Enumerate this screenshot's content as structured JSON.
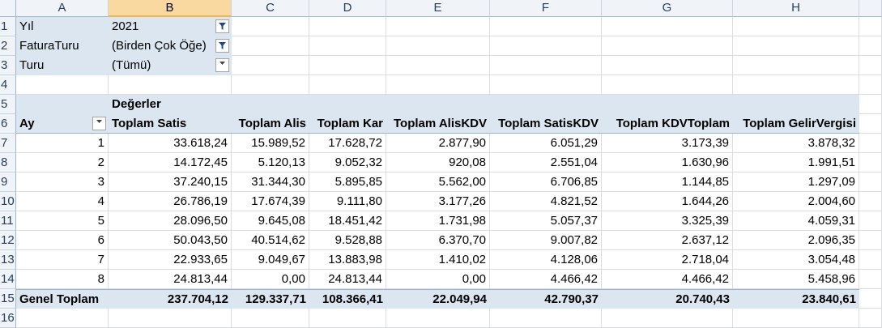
{
  "columns": [
    "A",
    "B",
    "C",
    "D",
    "E",
    "F",
    "G",
    "H"
  ],
  "selected_column": "B",
  "row_numbers": [
    "1",
    "2",
    "3",
    "4",
    "5",
    "6",
    "7",
    "8",
    "9",
    "10",
    "11",
    "12",
    "13",
    "14",
    "15",
    "16"
  ],
  "filters": [
    {
      "label": "Yıl",
      "value": "2021",
      "filtered": true
    },
    {
      "label": "FaturaTuru",
      "value": "(Birden Çok Öğe)",
      "filtered": true
    },
    {
      "label": "Turu",
      "value": "(Tümü)",
      "filtered": false
    }
  ],
  "pivot": {
    "values_caption": "Değerler",
    "row_field": "Ay",
    "headers": [
      "Toplam Satis",
      "Toplam Alis",
      "Toplam Kar",
      "Toplam AlisKDV",
      "Toplam SatisKDV",
      "Toplam KDVToplam",
      "Toplam GelirVergisi"
    ],
    "rows": [
      {
        "ay": "1",
        "values": [
          "33.618,24",
          "15.989,52",
          "17.628,72",
          "2.877,90",
          "6.051,29",
          "3.173,39",
          "3.878,32"
        ]
      },
      {
        "ay": "2",
        "values": [
          "14.172,45",
          "5.120,13",
          "9.052,32",
          "920,08",
          "2.551,04",
          "1.630,96",
          "1.991,51"
        ]
      },
      {
        "ay": "3",
        "values": [
          "37.240,15",
          "31.344,30",
          "5.895,85",
          "5.562,00",
          "6.706,85",
          "1.144,85",
          "1.297,09"
        ]
      },
      {
        "ay": "4",
        "values": [
          "26.786,19",
          "17.674,39",
          "9.111,80",
          "3.177,26",
          "4.821,52",
          "1.644,26",
          "2.004,60"
        ]
      },
      {
        "ay": "5",
        "values": [
          "28.096,50",
          "9.645,08",
          "18.451,42",
          "1.731,98",
          "5.057,37",
          "3.325,39",
          "4.059,31"
        ]
      },
      {
        "ay": "6",
        "values": [
          "50.043,50",
          "40.514,62",
          "9.528,88",
          "6.370,70",
          "9.007,82",
          "2.637,12",
          "2.096,35"
        ]
      },
      {
        "ay": "7",
        "values": [
          "22.933,65",
          "9.049,67",
          "13.883,98",
          "1.410,02",
          "4.128,06",
          "2.718,04",
          "3.054,48"
        ]
      },
      {
        "ay": "8",
        "values": [
          "24.813,44",
          "0,00",
          "24.813,44",
          "0,00",
          "4.466,42",
          "4.466,42",
          "5.458,96"
        ]
      }
    ],
    "total_label": "Genel Toplam",
    "totals": [
      "237.704,12",
      "129.337,71",
      "108.366,41",
      "22.049,94",
      "42.790,37",
      "20.740,43",
      "23.840,61"
    ]
  }
}
